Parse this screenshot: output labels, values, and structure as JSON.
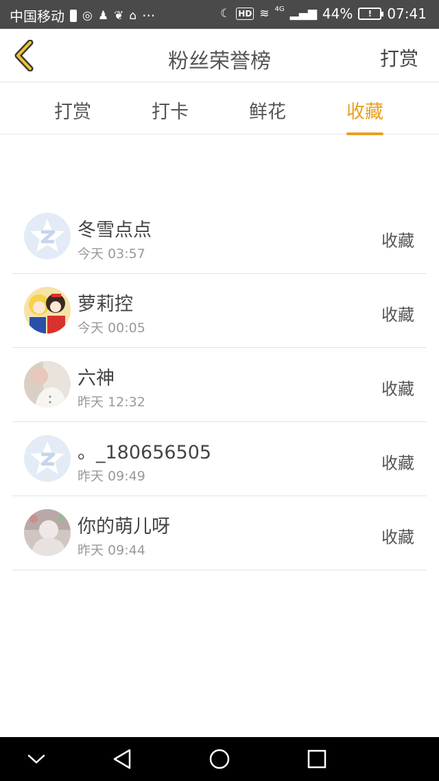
{
  "status_bar": {
    "carrier": "中国移动",
    "extra": "···",
    "network": "4G",
    "battery": "44%",
    "time": "07:41",
    "hd": "HD",
    "battery_icon_text": "!"
  },
  "header": {
    "title": "粉丝荣誉榜",
    "action_label": "打赏"
  },
  "tabs": [
    {
      "label": "打赏",
      "active": false
    },
    {
      "label": "打卡",
      "active": false
    },
    {
      "label": "鲜花",
      "active": false
    },
    {
      "label": "收藏",
      "active": true
    }
  ],
  "list": [
    {
      "name": "冬雪点点",
      "time": "今天 03:57",
      "action": "收藏",
      "avatar": "default-avatar"
    },
    {
      "name": "萝莉控",
      "time": "今天 00:05",
      "action": "收藏",
      "avatar": "anime-avatar"
    },
    {
      "name": "六神",
      "time": "昨天 12:32",
      "action": "收藏",
      "avatar": "photo-avatar"
    },
    {
      "name": "。_180656505",
      "time": "昨天 09:49",
      "action": "收藏",
      "avatar": "default-avatar"
    },
    {
      "name": "你的萌儿呀",
      "time": "昨天 09:44",
      "action": "收藏",
      "avatar": "photo-avatar"
    }
  ],
  "colors": {
    "accent": "#e8a020",
    "status_bar": "#4a4a4a",
    "nav_bar": "#000000"
  }
}
